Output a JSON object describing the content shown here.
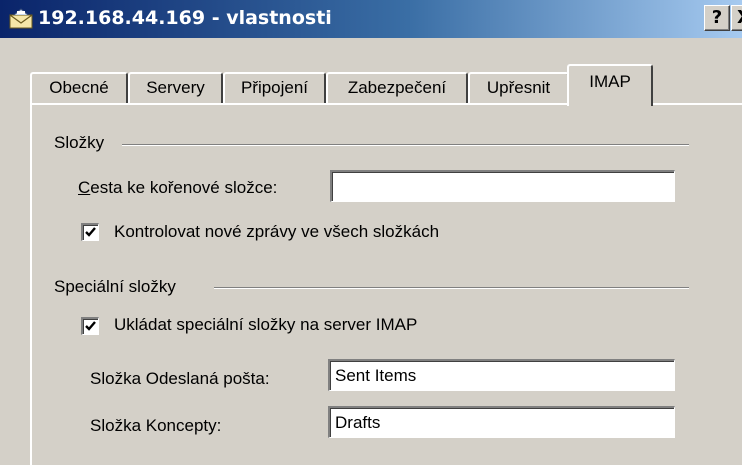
{
  "window": {
    "title": "192.168.44.169 - vlastnosti",
    "help_label": "?",
    "close_label": "X"
  },
  "tabs": [
    {
      "label": "Obecné"
    },
    {
      "label": "Servery"
    },
    {
      "label": "Připojení"
    },
    {
      "label": "Zabezpečení"
    },
    {
      "label": "Upřesnit"
    },
    {
      "label": "IMAP",
      "active": true
    }
  ],
  "folders_group": {
    "title": "Složky",
    "root_path": {
      "label": "Cesta ke kořenové složce:",
      "mnemonic": "C",
      "value": ""
    },
    "check_new": {
      "label": "Kontrolovat nové zprávy ve všech složkách",
      "checked": true
    }
  },
  "special_group": {
    "title": "Speciální složky",
    "store_on_server": {
      "label": "Ukládat speciální složky na server IMAP",
      "checked": true
    },
    "sent_folder": {
      "label": "Složka Odeslaná pošta:",
      "value": "Sent Items"
    },
    "drafts_folder": {
      "label": "Složka Koncepty:",
      "value": "Drafts"
    }
  }
}
